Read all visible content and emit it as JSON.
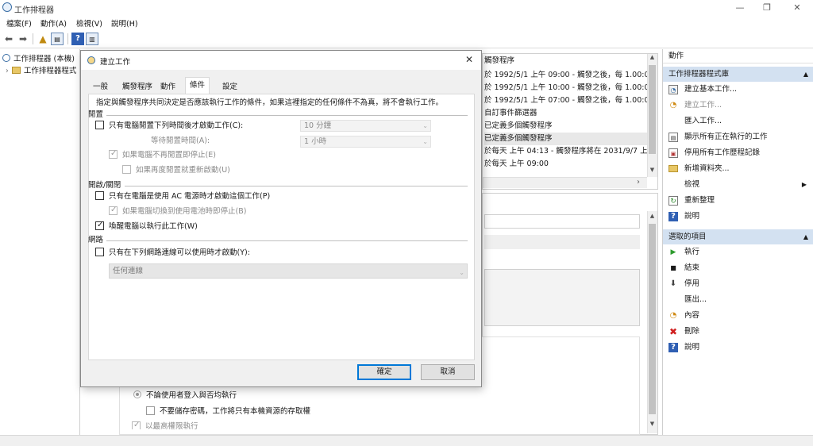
{
  "window": {
    "title": "工作排程器",
    "controls": [
      "—",
      "❐",
      "✕"
    ]
  },
  "menu": [
    "檔案(F)",
    "動作(A)",
    "檢視(V)",
    "說明(H)"
  ],
  "tree": {
    "root": "工作排程器 (本機)",
    "child": "工作排程器程式"
  },
  "triggers": {
    "header": "觸發程序",
    "rows": [
      "於 1992/5/1 上午 09:00 - 觸發之後，每 1.00:00",
      "於 1992/5/1 上午 10:00 - 觸發之後，每 1.00:00",
      "於 1992/5/1 上午 07:00 - 觸發之後，每 1.00:00",
      "自訂事件篩選器",
      "已定義多個觸發程序",
      "已定義多個觸發程序",
      "於每天 上午 04:13 - 觸發程序將在 2031/9/7 上",
      "於每天 上午 09:00"
    ]
  },
  "background_general": {
    "radio_label": "不論使用者登入與否均執行",
    "checkbox_label": "不要儲存密碼，工作將只有本機資源的存取權",
    "partial_label": "以最高權限執行"
  },
  "actions_pane": {
    "header": "動作",
    "section1": "工作排程器程式庫",
    "items1": [
      {
        "icon": "create-basic-task-icon",
        "label": "建立基本工作..."
      },
      {
        "icon": "create-task-icon",
        "label": "建立工作..."
      },
      {
        "icon": "",
        "label": "匯入工作..."
      },
      {
        "icon": "running-tasks-icon",
        "label": "顯示所有正在執行的工作"
      },
      {
        "icon": "history-icon",
        "label": "停用所有工作歷程記錄"
      },
      {
        "icon": "folder-icon",
        "label": "新增資料夾..."
      },
      {
        "icon": "",
        "label": "檢視"
      },
      {
        "icon": "refresh-icon",
        "label": "重新整理"
      },
      {
        "icon": "help-icon",
        "label": "說明"
      }
    ],
    "section2": "選取的項目",
    "items2": [
      {
        "icon": "run-icon",
        "label": "執行"
      },
      {
        "icon": "end-icon",
        "label": "結束"
      },
      {
        "icon": "disable-icon",
        "label": "停用"
      },
      {
        "icon": "",
        "label": "匯出..."
      },
      {
        "icon": "properties-icon",
        "label": "內容"
      },
      {
        "icon": "delete-icon",
        "label": "刪除"
      },
      {
        "icon": "help-icon",
        "label": "說明"
      }
    ]
  },
  "dialog": {
    "title": "建立工作",
    "close": "✕",
    "tabs": [
      "一般",
      "觸發程序",
      "動作",
      "條件",
      "設定"
    ],
    "active_tab": "條件",
    "description": "指定與觸發程序共同決定是否應該執行工作的條件，如果這裡指定的任何條件不為真，將不會執行工作。",
    "idle": {
      "group": "閒置",
      "start_if_idle": "只有電腦閒置下列時間後才啟動工作(C):",
      "idle_time_value": "10 分鐘",
      "wait_label": "等待閒置時間(A):",
      "wait_value": "1 小時",
      "stop_if_not_idle": "如果電腦不再閒置即停止(E)",
      "restart_if_idle": "如果再度閒置就重新啟動(U)"
    },
    "power": {
      "group": "開啟/關閉",
      "ac_only": "只有在電腦是使用 AC 電源時才啟動這個工作(P)",
      "stop_on_battery": "如果電腦切換到使用電池時即停止(B)",
      "wake": "喚醒電腦以執行此工作(W)"
    },
    "network": {
      "group": "網路",
      "only_if_network": "只有在下列網路連線可以使用時才啟動(Y):",
      "connection_value": "任何連線"
    },
    "ok": "確定",
    "cancel": "取消"
  }
}
